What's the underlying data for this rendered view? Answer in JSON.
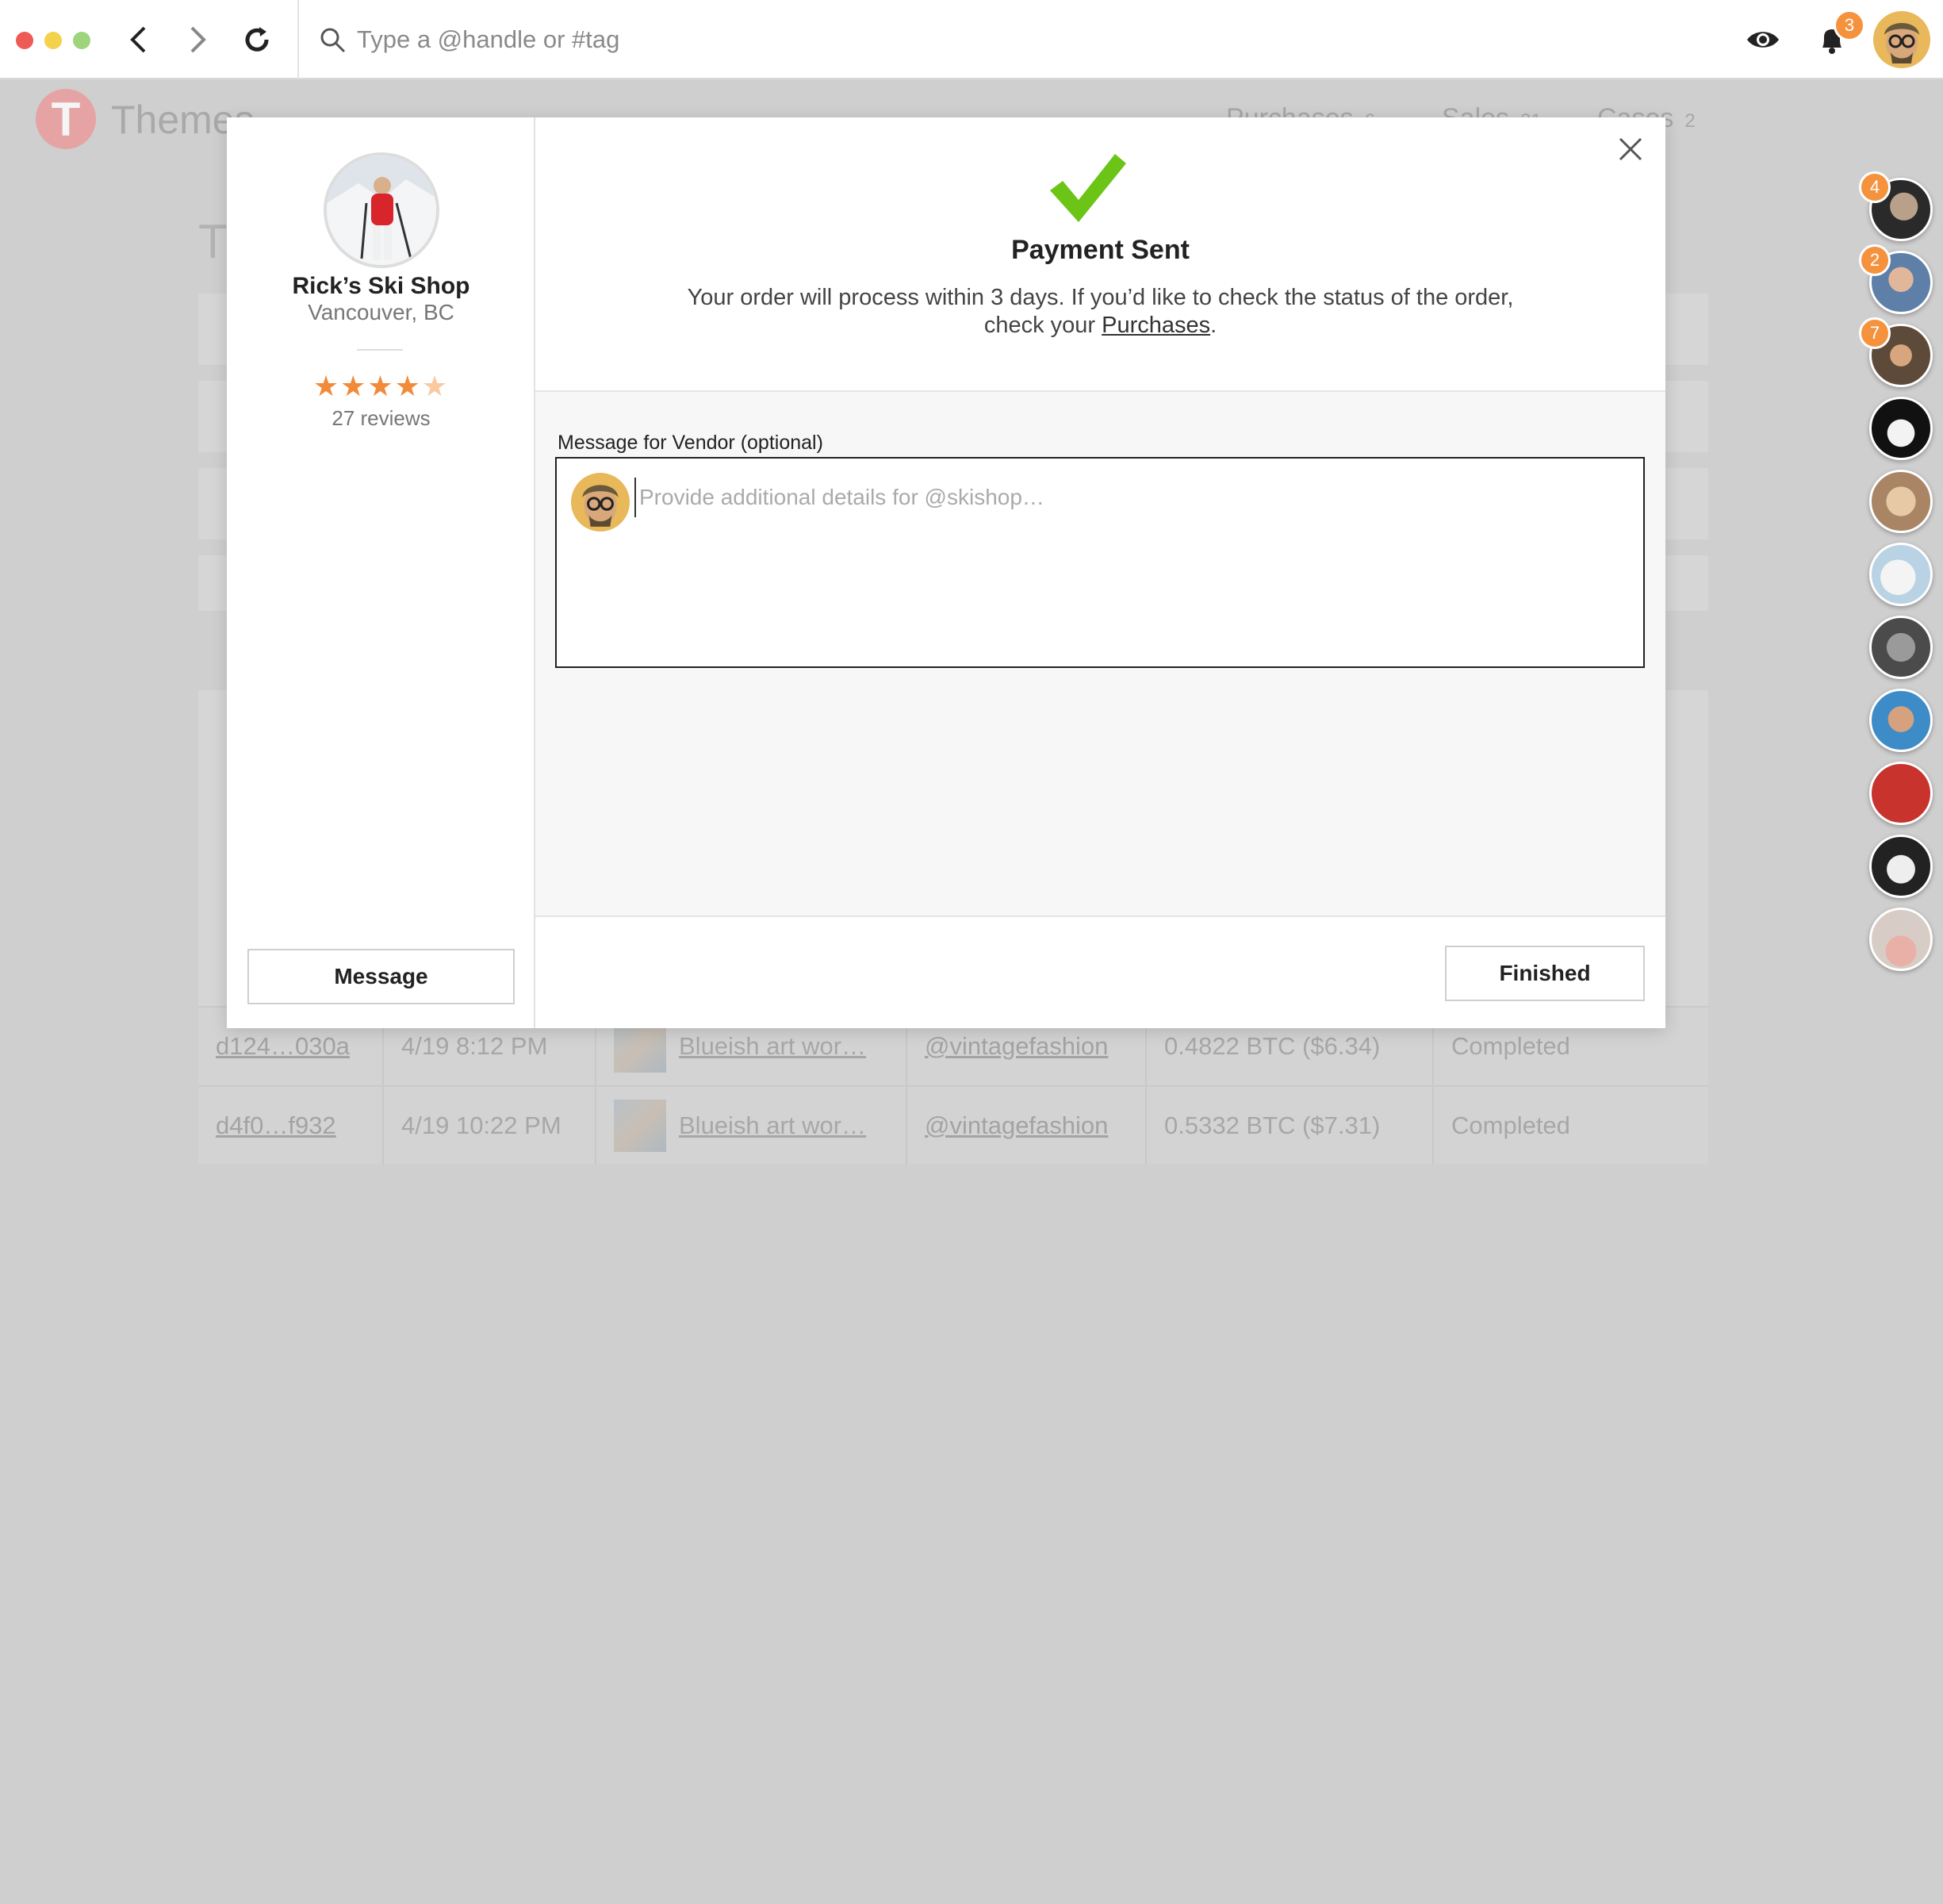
{
  "topbar": {
    "search_placeholder": "Type a @handle or #tag",
    "notifications_count": "3",
    "colors": {
      "close": "#ee5a56",
      "minimize": "#f5d24b",
      "maximize": "#9dd47c",
      "badge": "#f5923e"
    }
  },
  "background": {
    "brand": "Themes",
    "tabs": [
      {
        "label": "Purchases",
        "count": "6"
      },
      {
        "label": "Sales",
        "count": "31"
      },
      {
        "label": "Cases",
        "count": "2"
      }
    ],
    "heading": "Th",
    "rows": [
      {
        "id": "d124…030a",
        "date": "4/19 8:12 PM",
        "item": "Blueish art wor…",
        "vendor": "@vintagefashion",
        "price": "0.4822 BTC ($6.34)",
        "status": "Completed"
      },
      {
        "id": "d4f0…f932",
        "date": "4/19 10:22 PM",
        "item": "Blueish art wor…",
        "vendor": "@vintagefashion",
        "price": "0.5332 BTC ($7.31)",
        "status": "Completed"
      }
    ]
  },
  "rail": {
    "badges": [
      "4",
      "2",
      "7"
    ]
  },
  "vendor": {
    "name": "Rick’s Ski Shop",
    "location": "Vancouver, BC",
    "rating": 4.5,
    "stars": "★★★★",
    "half_star": "★",
    "reviews": "27 reviews",
    "message_button": "Message"
  },
  "modal": {
    "title": "Payment Sent",
    "message_pre": "Your order will process within 3 days. If you’d like to check the status of the order, check your ",
    "message_link": "Purchases",
    "message_post": ".",
    "vendor_message_label": "Message for Vendor (optional)",
    "vendor_message_placeholder": "Provide additional details for @skishop…",
    "finished_button": "Finished",
    "check_color": "#6cc417"
  }
}
